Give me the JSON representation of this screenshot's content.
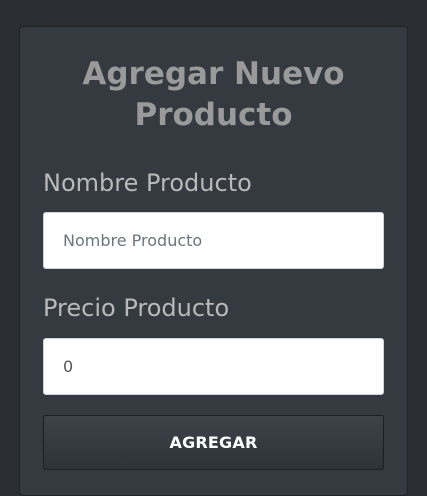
{
  "form": {
    "title": "Agregar Nuevo Producto",
    "name_label": "Nombre Producto",
    "name_placeholder": "Nombre Producto",
    "name_value": "",
    "price_label": "Precio Producto",
    "price_value": "0",
    "submit_label": "AGREGAR"
  }
}
